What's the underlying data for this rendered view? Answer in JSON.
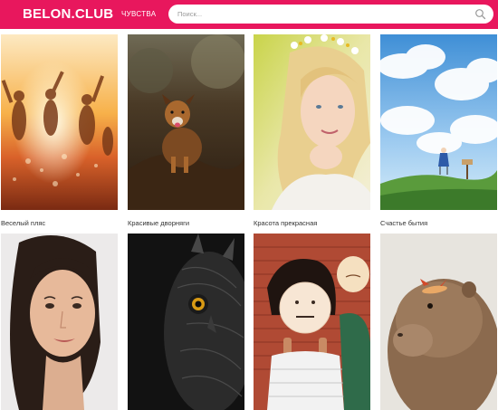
{
  "header": {
    "logo_main": "BELON",
    "logo_dot": ".",
    "logo_tail": "CLUB",
    "nav_label": "ЧУВСТВА",
    "brand_color": "#e8175d"
  },
  "search": {
    "placeholder": "Поиск...",
    "value": "",
    "icon": "search-icon"
  },
  "gallery": {
    "items": [
      {
        "caption": "Веселый пляс"
      },
      {
        "caption": "Красивые дворняги"
      },
      {
        "caption": "Красота прекрасная"
      },
      {
        "caption": "Счастье бытия"
      },
      {
        "caption": ""
      },
      {
        "caption": ""
      },
      {
        "caption": ""
      },
      {
        "caption": ""
      }
    ]
  }
}
